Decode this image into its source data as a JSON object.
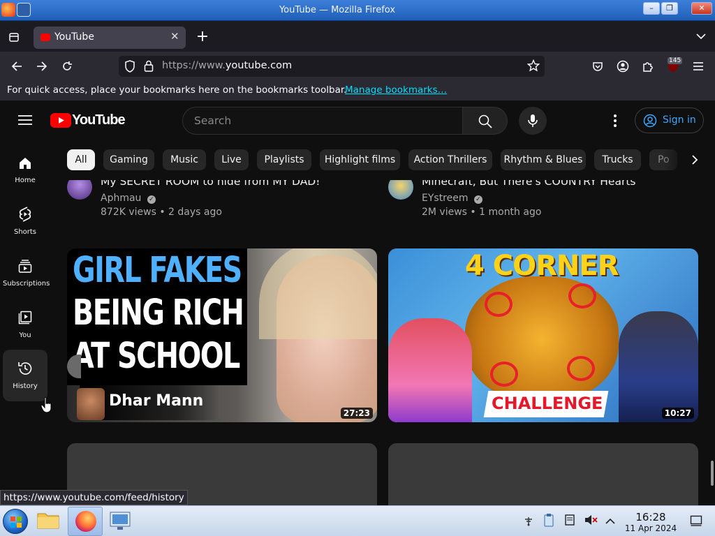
{
  "window": {
    "title": "YouTube — Mozilla Firefox",
    "controls": [
      "–",
      "❐",
      "✕"
    ]
  },
  "browser": {
    "tab_title": "YouTube",
    "new_tab": "+",
    "url_prefix": "https://www.",
    "url_host": "youtube.com",
    "url_suffix": ".com",
    "extension_badge": "145",
    "bookmarks_text": "For quick access, place your bookmarks here on the bookmarks toolbar.",
    "bookmarks_link": "Manage bookmarks…"
  },
  "youtube": {
    "logo_text": "YouTube",
    "search_placeholder": "Search",
    "sign_in": "Sign in",
    "chips": [
      "All",
      "Gaming",
      "Music",
      "Live",
      "Playlists",
      "Highlight films",
      "Action Thrillers",
      "Rhythm & Blues",
      "Trucks",
      "Po"
    ],
    "nav": [
      {
        "label": "Home"
      },
      {
        "label": "Shorts"
      },
      {
        "label": "Subscriptions"
      },
      {
        "label": "You"
      },
      {
        "label": "History"
      }
    ],
    "videos": [
      {
        "title": "My SECRET ROOM to hide from MY DAD!",
        "channel": "Aphmau",
        "meta": "872K views • 2 days ago"
      },
      {
        "title": "Minecraft, But There's COUNTRY Hearts",
        "channel": "EYstreem",
        "meta": "2M views • 1 month ago"
      }
    ],
    "thumbs": [
      {
        "line1": "GIRL FAKES",
        "line2": "BEING RICH",
        "line3": "AT SCHOOL",
        "brand": "Dhar Mann",
        "duration": "27:23"
      },
      {
        "top": "4 CORNER",
        "bottom": "CHALLENGE",
        "duration": "10:27"
      }
    ]
  },
  "status_url": "https://www.youtube.com/feed/history",
  "taskbar": {
    "time": "16:28",
    "date": "11 Apr 2024"
  },
  "colors": {
    "yt_red": "#ff0000",
    "link_blue": "#3ea6ff",
    "bg": "#0f0f0f"
  }
}
